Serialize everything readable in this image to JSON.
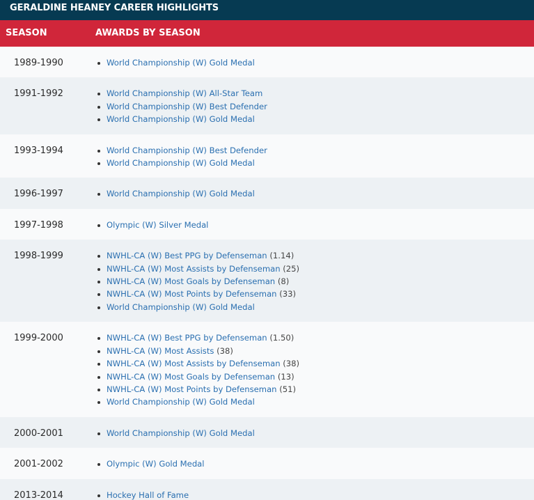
{
  "title": "GERALDINE HEANEY CAREER HIGHLIGHTS",
  "headers": {
    "season": "SEASON",
    "awards": "AWARDS BY SEASON"
  },
  "colors": {
    "title_bar": "#063a52",
    "header_bar": "#d0263a",
    "link": "#2a6fb0",
    "row_alt": "#edf1f4"
  },
  "rows": [
    {
      "season": "1989-1990",
      "awards": [
        {
          "label": "World Championship (W) Gold Medal",
          "value": ""
        }
      ]
    },
    {
      "season": "1991-1992",
      "awards": [
        {
          "label": "World Championship (W) All-Star Team",
          "value": ""
        },
        {
          "label": "World Championship (W) Best Defender",
          "value": ""
        },
        {
          "label": "World Championship (W) Gold Medal",
          "value": ""
        }
      ]
    },
    {
      "season": "1993-1994",
      "awards": [
        {
          "label": "World Championship (W) Best Defender",
          "value": ""
        },
        {
          "label": "World Championship (W) Gold Medal",
          "value": ""
        }
      ]
    },
    {
      "season": "1996-1997",
      "awards": [
        {
          "label": "World Championship (W) Gold Medal",
          "value": ""
        }
      ]
    },
    {
      "season": "1997-1998",
      "awards": [
        {
          "label": "Olympic (W) Silver Medal",
          "value": ""
        }
      ]
    },
    {
      "season": "1998-1999",
      "awards": [
        {
          "label": "NWHL-CA (W) Best PPG by Defenseman",
          "value": "(1.14)"
        },
        {
          "label": "NWHL-CA (W) Most Assists by Defenseman",
          "value": "(25)"
        },
        {
          "label": "NWHL-CA (W) Most Goals by Defenseman",
          "value": "(8)"
        },
        {
          "label": "NWHL-CA (W) Most Points by Defenseman",
          "value": "(33)"
        },
        {
          "label": "World Championship (W) Gold Medal",
          "value": ""
        }
      ]
    },
    {
      "season": "1999-2000",
      "awards": [
        {
          "label": "NWHL-CA (W) Best PPG by Defenseman",
          "value": "(1.50)"
        },
        {
          "label": "NWHL-CA (W) Most Assists",
          "value": "(38)"
        },
        {
          "label": "NWHL-CA (W) Most Assists by Defenseman",
          "value": "(38)"
        },
        {
          "label": "NWHL-CA (W) Most Goals by Defenseman",
          "value": "(13)"
        },
        {
          "label": "NWHL-CA (W) Most Points by Defenseman",
          "value": "(51)"
        },
        {
          "label": "World Championship (W) Gold Medal",
          "value": ""
        }
      ]
    },
    {
      "season": "2000-2001",
      "awards": [
        {
          "label": "World Championship (W) Gold Medal",
          "value": ""
        }
      ]
    },
    {
      "season": "2001-2002",
      "awards": [
        {
          "label": "Olympic (W) Gold Medal",
          "value": ""
        }
      ]
    },
    {
      "season": "2013-2014",
      "awards": [
        {
          "label": "Hockey Hall of Fame",
          "value": ""
        }
      ]
    }
  ]
}
